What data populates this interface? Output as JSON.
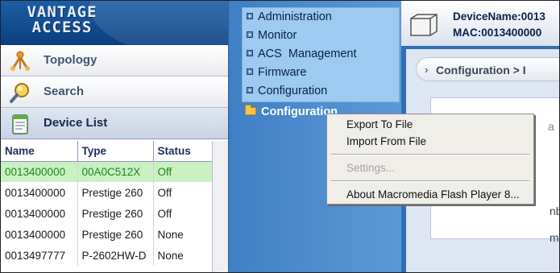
{
  "logo": {
    "line1": "VANTAGE",
    "line2": "ACCESS"
  },
  "sidebar": {
    "items": [
      {
        "label": "Topology",
        "icon": "topology-icon"
      },
      {
        "label": "Search",
        "icon": "magnifier-icon"
      },
      {
        "label": "Device List",
        "icon": "notepad-icon"
      }
    ]
  },
  "device_table": {
    "columns": [
      "Name",
      "Type",
      "Status"
    ],
    "rows": [
      [
        "0013400000",
        "00A0C512X",
        "Off"
      ],
      [
        "0013400000",
        "Prestige 260",
        "Off"
      ],
      [
        "0013400000",
        "Prestige 260",
        "Off"
      ],
      [
        "0013400000",
        "Prestige 260",
        "None"
      ],
      [
        "0013497777",
        "P-2602HW-D",
        "None"
      ]
    ],
    "selected_row": 0,
    "selected_color": "#c9f1c2"
  },
  "menu": {
    "items": [
      "Administration",
      "Monitor",
      "ACS  Management",
      "Firmware",
      "Configuration"
    ],
    "folder_label": "Configuration"
  },
  "device_header": {
    "name": "DeviceName:0013",
    "mac": "MAC:0013400000"
  },
  "breadcrumb": {
    "arrow": "›",
    "text": "Configuration > I"
  },
  "content_fragments": {
    "a": "a",
    "b": "nb",
    "c": "m"
  },
  "context_menu": {
    "items": [
      {
        "label": "Export To File",
        "enabled": true
      },
      {
        "label": "Import From File",
        "enabled": true
      },
      {
        "label": "Settings...",
        "enabled": false
      },
      {
        "label": "About Macromedia Flash Player 8...",
        "enabled": true
      }
    ]
  },
  "colors": {
    "accent": "#3f7fc4",
    "logo_bg": "#1b5ea8",
    "selection_text": "#1a8a1a",
    "menu_bg": "#f0eee8"
  }
}
